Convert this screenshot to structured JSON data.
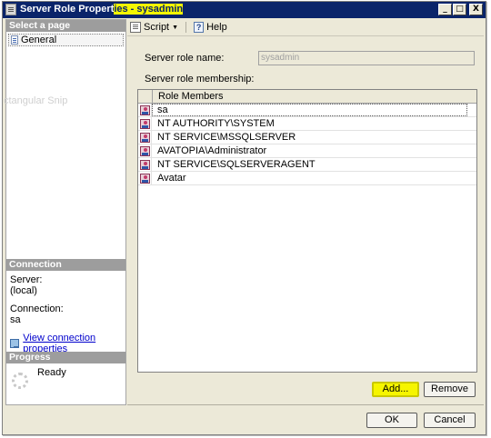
{
  "window": {
    "title_prefix": "Server Role Propert",
    "title_highlight": "ies - sysadmin",
    "controls": {
      "minimize": "_",
      "maximize": "□",
      "close": "X"
    }
  },
  "left_panel": {
    "select_page_header": "Select a page",
    "pages": [
      {
        "label": "General",
        "icon": "page-icon"
      }
    ],
    "ghost_text": "ctangular Snip",
    "connection_header": "Connection",
    "server_label": "Server:",
    "server_value": "(local)",
    "connection_label": "Connection:",
    "connection_value": "sa",
    "view_connection_link": "View connection properties",
    "progress_header": "Progress",
    "progress_status": "Ready"
  },
  "toolbar": {
    "script_label": "Script",
    "help_label": "Help"
  },
  "form": {
    "role_name_label": "Server role name:",
    "role_name_value": "sysadmin",
    "membership_label": "Server role membership:"
  },
  "grid": {
    "column_header": "Role Members",
    "rows": [
      {
        "name": "sa"
      },
      {
        "name": "NT AUTHORITY\\SYSTEM"
      },
      {
        "name": "NT SERVICE\\MSSQLSERVER"
      },
      {
        "name": "AVATOPIA\\Administrator"
      },
      {
        "name": "NT SERVICE\\SQLSERVERAGENT"
      },
      {
        "name": "Avatar"
      }
    ]
  },
  "buttons": {
    "add": "Add...",
    "remove": "Remove",
    "ok": "OK",
    "cancel": "Cancel"
  },
  "colors": {
    "title_bar": "#0a246a",
    "highlight": "#f4f600",
    "window_bg": "#ece9d8",
    "section_header": "#9d9d9d"
  }
}
